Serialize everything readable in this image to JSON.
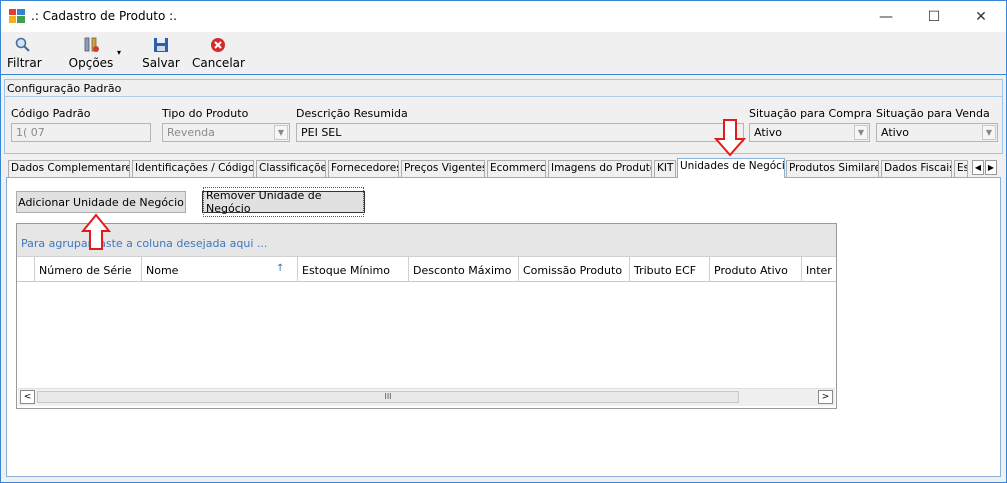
{
  "window": {
    "title": ".: Cadastro de Produto :.",
    "min": "—",
    "max": "☐",
    "close": "✕"
  },
  "toolbar": {
    "filtrar": "Filtrar",
    "opcoes": "Opções",
    "salvar": "Salvar",
    "cancelar": "Cancelar"
  },
  "config": {
    "title": "Configuração Padrão",
    "codigo_label": "Código Padrão",
    "codigo_value": "1(             07",
    "tipo_label": "Tipo do Produto",
    "tipo_value": "Revenda",
    "descricao_label": "Descrição Resumida",
    "descricao_value": "PEI                                            SEL",
    "sit_compra_label": "Situação para Compra",
    "sit_compra_value": "Ativo",
    "sit_venda_label": "Situação para Venda",
    "sit_venda_value": "Ativo"
  },
  "tabs": [
    "Dados Complementares",
    "Identificações / Códigos",
    "Classificações",
    "Fornecedores",
    "Preços Vigentes",
    "Ecommerce",
    "Imagens do Produto",
    "KIT",
    "Unidades de Negócio",
    "Produtos Similares",
    "Dados Fiscais",
    "Es"
  ],
  "active_tab": "Unidades de Negócio",
  "page": {
    "add_btn": "Adicionar Unidade de Negócio",
    "remove_btn": "Remover Unidade de Negócio"
  },
  "grid": {
    "groupby": "Para agrupar,      aste a coluna desejada aqui ...",
    "columns": [
      "Número de Série",
      "Nome",
      "Estoque Mínimo",
      "Desconto Máximo",
      "Comissão Produto",
      "Tributo ECF",
      "Produto Ativo",
      "Inter"
    ],
    "sort_icon": "↑",
    "scroll_left": "<",
    "scroll_right": ">",
    "thumb": "III"
  }
}
